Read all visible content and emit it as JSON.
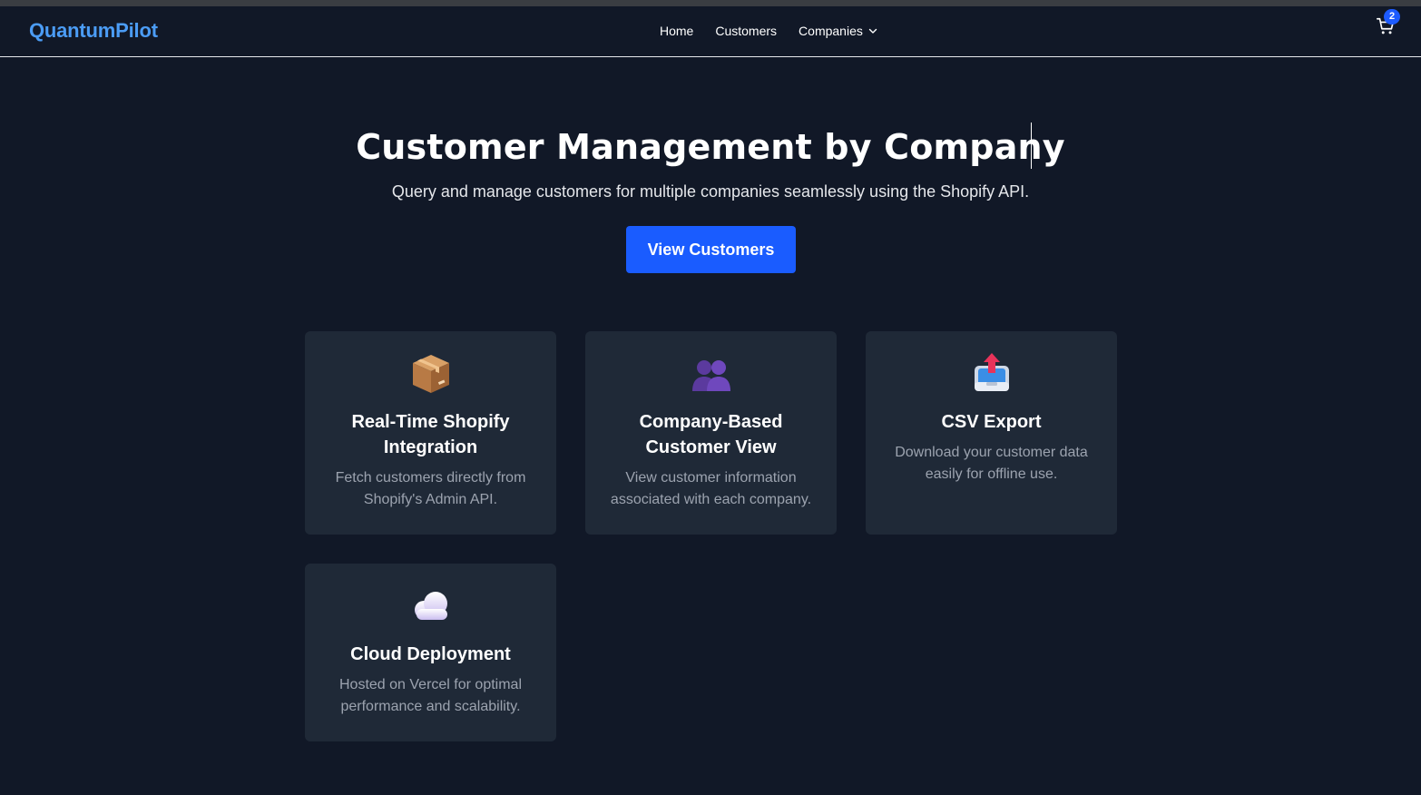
{
  "brand": "QuantumPilot",
  "nav": {
    "links": [
      "Home",
      "Customers"
    ],
    "dropdown_label": "Companies",
    "cart_count": "2"
  },
  "hero": {
    "title": "Customer Management by Company",
    "subtitle": "Query and manage customers for multiple companies seamlessly using the Shopify API.",
    "cta_label": "View Customers"
  },
  "features": [
    {
      "icon": "package-icon",
      "title": "Real-Time Shopify Integration",
      "description": "Fetch customers directly from Shopify's Admin API."
    },
    {
      "icon": "people-icon",
      "title": "Company-Based Customer View",
      "description": "View customer information associated with each company."
    },
    {
      "icon": "outbox-tray-icon",
      "title": "CSV Export",
      "description": "Download your customer data easily for offline use."
    },
    {
      "icon": "cloud-icon",
      "title": "Cloud Deployment",
      "description": "Hosted on Vercel for optimal performance and scalability."
    }
  ],
  "colors": {
    "background": "#111827",
    "card": "#1f2937",
    "brand": "#4b9cf5",
    "primary_button": "#1a5cff"
  }
}
